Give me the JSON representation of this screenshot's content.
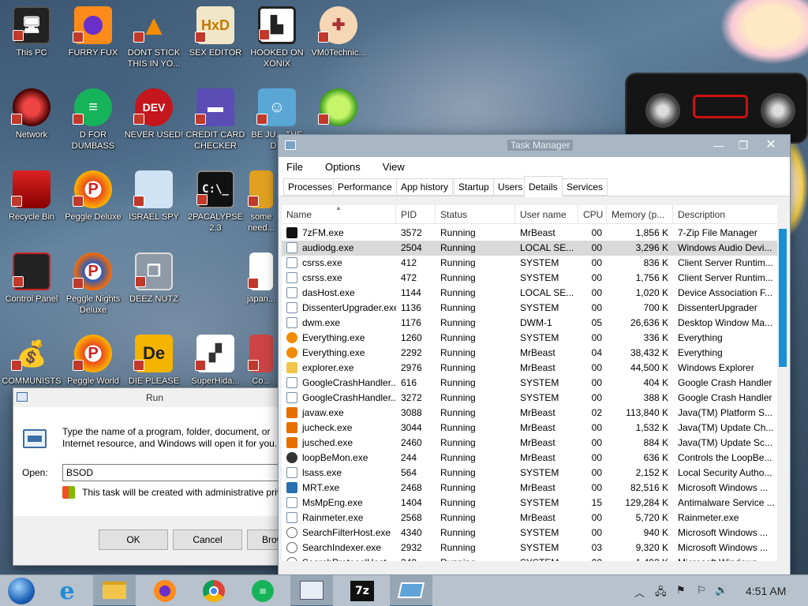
{
  "desktop": {
    "icons": [
      {
        "label": "This PC",
        "icon": "monitor-icon"
      },
      {
        "label": "FURRY FUX",
        "icon": "firefox-icon"
      },
      {
        "label": "DONT STICK THIS IN YO...",
        "icon": "vlc-cone-icon"
      },
      {
        "label": "SEX EDITOR",
        "icon": "hxd-editor-icon"
      },
      {
        "label": "HOOKED ON XONIX",
        "icon": "xonix-game-icon"
      },
      {
        "label": "VM0Technic...",
        "icon": "doctor-icon"
      },
      {
        "label": "Network",
        "icon": "network-orb-icon"
      },
      {
        "label": "D FOR DUMBASS",
        "icon": "discord-like-icon"
      },
      {
        "label": "NEVER USED!",
        "icon": "devcpp-icon"
      },
      {
        "label": "CREDIT CARD CHECKER",
        "icon": "credit-card-icon"
      },
      {
        "label": "BE JU... THE D...",
        "icon": "gnome-icon"
      },
      {
        "label": "Recycle Bin",
        "icon": "recycle-bin-icon"
      },
      {
        "label": "Peggle Deluxe",
        "icon": "peggle-icon"
      },
      {
        "label": "ISRAEL SPY",
        "icon": "spy-computer-icon"
      },
      {
        "label": "2PACALYPSE 2.3",
        "icon": "terminal-icon"
      },
      {
        "label": "some need...",
        "icon": "app-icon"
      },
      {
        "label": "Control Panel",
        "icon": "control-panel-icon"
      },
      {
        "label": "Peggle Nights Deluxe",
        "icon": "peggle-nights-icon"
      },
      {
        "label": "DEEZ NUTZ",
        "icon": "stacked-windows-icon"
      },
      {
        "label": "japan...",
        "icon": "document-icon"
      },
      {
        "label": "COMMUNISTS",
        "icon": "money-bag-icon"
      },
      {
        "label": "Peggle World",
        "icon": "peggle-world-icon"
      },
      {
        "label": "DIE PLEASE",
        "icon": "de-icon"
      },
      {
        "label": "SuperHida...",
        "icon": "pixel-dog-icon"
      },
      {
        "label": "Co... Ba...",
        "icon": "app-icon"
      }
    ]
  },
  "run_dialog": {
    "title": "Run",
    "description": "Type the name of a program, folder, document, or Internet resource, and Windows will open it for you.",
    "open_label": "Open:",
    "input_value": "BSOD",
    "admin_note": "This task will be created with administrative privileges.",
    "buttons": {
      "ok": "OK",
      "cancel": "Cancel",
      "browse": "Browse..."
    }
  },
  "task_manager": {
    "title": "Task Manager",
    "menu": [
      "File",
      "Options",
      "View"
    ],
    "tabs": [
      "Processes",
      "Performance",
      "App history",
      "Startup",
      "Users",
      "Details",
      "Services"
    ],
    "active_tab": "Details",
    "columns": [
      "Name",
      "PID",
      "Status",
      "User name",
      "CPU",
      "Memory (p...",
      "Description"
    ],
    "rows": [
      {
        "name": "7zFM.exe",
        "pid": "3572",
        "status": "Running",
        "user": "MrBeast",
        "cpu": "00",
        "mem": "1,856 K",
        "desc": "7-Zip File Manager",
        "icon": "7z"
      },
      {
        "name": "audiodg.exe",
        "pid": "2504",
        "status": "Running",
        "user": "LOCAL SE...",
        "cpu": "00",
        "mem": "3,296 K",
        "desc": "Windows Audio Devi...",
        "icon": "win"
      },
      {
        "name": "csrss.exe",
        "pid": "412",
        "status": "Running",
        "user": "SYSTEM",
        "cpu": "00",
        "mem": "836 K",
        "desc": "Client Server Runtim...",
        "icon": "win"
      },
      {
        "name": "csrss.exe",
        "pid": "472",
        "status": "Running",
        "user": "SYSTEM",
        "cpu": "00",
        "mem": "1,756 K",
        "desc": "Client Server Runtim...",
        "icon": "win"
      },
      {
        "name": "dasHost.exe",
        "pid": "1144",
        "status": "Running",
        "user": "LOCAL SE...",
        "cpu": "00",
        "mem": "1,020 K",
        "desc": "Device Association F...",
        "icon": "win"
      },
      {
        "name": "DissenterUpgrader.exe",
        "pid": "1136",
        "status": "Running",
        "user": "SYSTEM",
        "cpu": "00",
        "mem": "700 K",
        "desc": "DissenterUpgrader",
        "icon": "win"
      },
      {
        "name": "dwm.exe",
        "pid": "1176",
        "status": "Running",
        "user": "DWM-1",
        "cpu": "05",
        "mem": "26,636 K",
        "desc": "Desktop Window Ma...",
        "icon": "win"
      },
      {
        "name": "Everything.exe",
        "pid": "1260",
        "status": "Running",
        "user": "SYSTEM",
        "cpu": "00",
        "mem": "336 K",
        "desc": "Everything",
        "icon": "search"
      },
      {
        "name": "Everything.exe",
        "pid": "2292",
        "status": "Running",
        "user": "MrBeast",
        "cpu": "04",
        "mem": "38,432 K",
        "desc": "Everything",
        "icon": "search"
      },
      {
        "name": "explorer.exe",
        "pid": "2976",
        "status": "Running",
        "user": "MrBeast",
        "cpu": "00",
        "mem": "44,500 K",
        "desc": "Windows Explorer",
        "icon": "folder"
      },
      {
        "name": "GoogleCrashHandler...",
        "pid": "616",
        "status": "Running",
        "user": "SYSTEM",
        "cpu": "00",
        "mem": "404 K",
        "desc": "Google Crash Handler",
        "icon": "win"
      },
      {
        "name": "GoogleCrashHandler...",
        "pid": "3272",
        "status": "Running",
        "user": "SYSTEM",
        "cpu": "00",
        "mem": "388 K",
        "desc": "Google Crash Handler",
        "icon": "win"
      },
      {
        "name": "javaw.exe",
        "pid": "3088",
        "status": "Running",
        "user": "MrBeast",
        "cpu": "02",
        "mem": "113,840 K",
        "desc": "Java(TM) Platform S...",
        "icon": "java"
      },
      {
        "name": "jucheck.exe",
        "pid": "3044",
        "status": "Running",
        "user": "MrBeast",
        "cpu": "00",
        "mem": "1,532 K",
        "desc": "Java(TM) Update Ch...",
        "icon": "java"
      },
      {
        "name": "jusched.exe",
        "pid": "2460",
        "status": "Running",
        "user": "MrBeast",
        "cpu": "00",
        "mem": "884 K",
        "desc": "Java(TM) Update Sc...",
        "icon": "java"
      },
      {
        "name": "loopBeMon.exe",
        "pid": "244",
        "status": "Running",
        "user": "MrBeast",
        "cpu": "00",
        "mem": "636 K",
        "desc": "Controls the LoopBe...",
        "icon": "loop"
      },
      {
        "name": "lsass.exe",
        "pid": "564",
        "status": "Running",
        "user": "SYSTEM",
        "cpu": "00",
        "mem": "2,152 K",
        "desc": "Local Security Autho...",
        "icon": "win"
      },
      {
        "name": "MRT.exe",
        "pid": "2468",
        "status": "Running",
        "user": "MrBeast",
        "cpu": "00",
        "mem": "82,516 K",
        "desc": "Microsoft Windows ...",
        "icon": "shield"
      },
      {
        "name": "MsMpEng.exe",
        "pid": "1404",
        "status": "Running",
        "user": "SYSTEM",
        "cpu": "15",
        "mem": "129,284 K",
        "desc": "Antimalware Service ...",
        "icon": "win"
      },
      {
        "name": "Rainmeter.exe",
        "pid": "2568",
        "status": "Running",
        "user": "MrBeast",
        "cpu": "00",
        "mem": "5,720 K",
        "desc": "Rainmeter.exe",
        "icon": "win"
      },
      {
        "name": "SearchFilterHost.exe",
        "pid": "4340",
        "status": "Running",
        "user": "SYSTEM",
        "cpu": "00",
        "mem": "940 K",
        "desc": "Microsoft Windows ...",
        "icon": "search2"
      },
      {
        "name": "SearchIndexer.exe",
        "pid": "2932",
        "status": "Running",
        "user": "SYSTEM",
        "cpu": "03",
        "mem": "9,320 K",
        "desc": "Microsoft Windows ...",
        "icon": "search2"
      },
      {
        "name": "SearchProtocolHost...",
        "pid": "340",
        "status": "Running",
        "user": "SYSTEM",
        "cpu": "00",
        "mem": "1,492 K",
        "desc": "Microsoft Windows ...",
        "icon": "search2"
      }
    ]
  },
  "taskbar": {
    "apps": [
      "start-orb-icon",
      "internet-explorer-icon",
      "file-explorer-icon",
      "firefox-icon",
      "chrome-icon",
      "green-app-icon",
      "task-manager-icon",
      "7zip-icon",
      "run-dialog-icon"
    ],
    "clock": "4:51 AM"
  },
  "colors": {
    "selection": "#d9d9d9",
    "scroll_thumb": "#1b8fd6",
    "titlebar": "#a9b7c4"
  }
}
